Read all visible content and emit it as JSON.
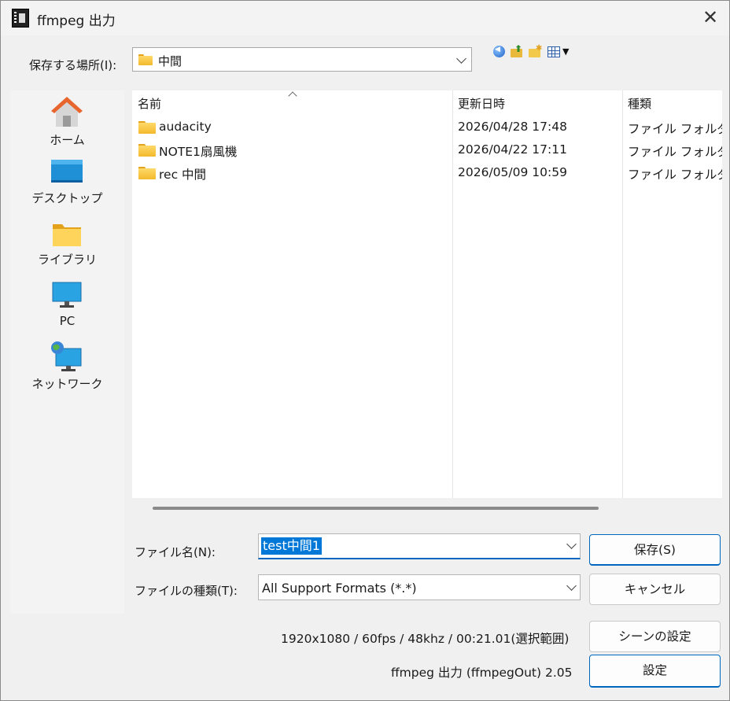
{
  "window": {
    "title": "ffmpeg 出力",
    "close_symbol": "✕"
  },
  "location": {
    "label": "保存する場所(I):",
    "current": "中間"
  },
  "toolbar": {
    "icons": [
      "back-icon",
      "up-folder-icon",
      "new-folder-icon",
      "view-menu-icon"
    ],
    "view_arrow": "▼"
  },
  "places": [
    {
      "label": "ホーム",
      "icon": "home-icon"
    },
    {
      "label": "デスクトップ",
      "icon": "desktop-icon"
    },
    {
      "label": "ライブラリ",
      "icon": "library-icon"
    },
    {
      "label": "PC",
      "icon": "pc-icon"
    },
    {
      "label": "ネットワーク",
      "icon": "network-icon"
    }
  ],
  "columns": {
    "name": "名前",
    "date": "更新日時",
    "type": "種類"
  },
  "files": [
    {
      "name": "audacity",
      "date": "2026/04/28 17:48",
      "type": "ファイル フォルダー"
    },
    {
      "name": "NOTE1扇風機",
      "date": "2026/04/22 17:11",
      "type": "ファイル フォルダー"
    },
    {
      "name": "rec 中間",
      "date": "2026/05/09 10:59",
      "type": "ファイル フォルダー"
    }
  ],
  "filename": {
    "label": "ファイル名(N):",
    "value": "test中間1"
  },
  "filetype": {
    "label": "ファイルの種類(T):",
    "value": "All Support Formats (*.*)"
  },
  "buttons": {
    "save": "保存(S)",
    "cancel": "キャンセル",
    "scene_settings": "シーンの設定",
    "settings": "設定"
  },
  "info": {
    "video": "1920x1080 / 60fps / 48khz / 00:21.01(選択範囲)",
    "plugin": "ffmpeg 出力 (ffmpegOut) 2.05"
  },
  "colors": {
    "accent": "#0067c0",
    "selection": "#0078d7",
    "folder": "#f3b92c"
  }
}
